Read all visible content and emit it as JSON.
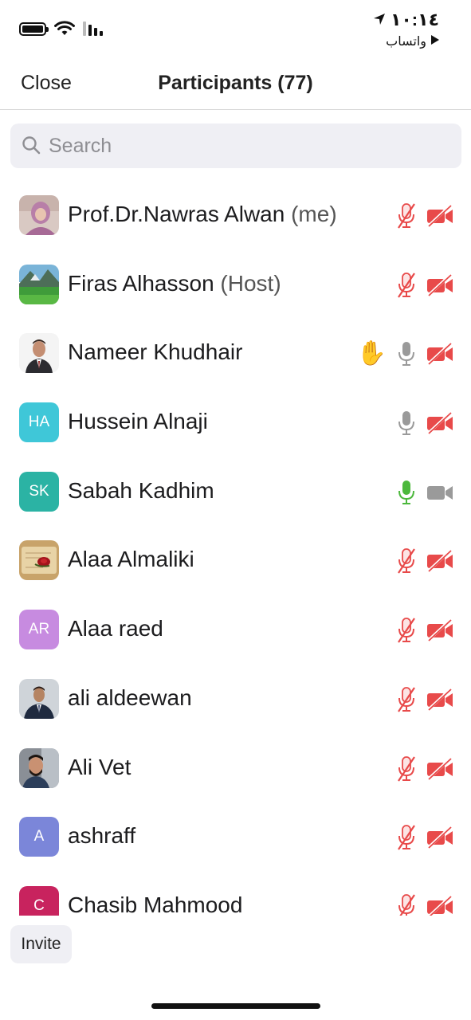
{
  "status_bar": {
    "time": "١٠:١٤",
    "back_app": "واتساب",
    "icons": [
      "battery-icon",
      "wifi-icon",
      "signal-icon",
      "location-arrow-icon"
    ]
  },
  "nav": {
    "close_label": "Close",
    "title": "Participants (77)"
  },
  "search": {
    "placeholder": "Search"
  },
  "colors": {
    "muted_red": "#e84a4a",
    "neutral_gray": "#9a9a9a",
    "active_green": "#4cb83c"
  },
  "participants": [
    {
      "name": "Prof.Dr.Nawras Alwan",
      "suffix": "(me)",
      "avatar": "photo",
      "hand": false,
      "mic": "muted",
      "video": "off"
    },
    {
      "name": "Firas Alhasson",
      "suffix": "(Host)",
      "avatar": "photo",
      "hand": false,
      "mic": "muted",
      "video": "off"
    },
    {
      "name": "Nameer Khudhair",
      "suffix": "",
      "avatar": "photo",
      "hand": true,
      "mic": "unmuted",
      "video": "off"
    },
    {
      "name": "Hussein Alnaji",
      "suffix": "",
      "avatar": "HA",
      "avatar_color": "#3fc7d8",
      "hand": false,
      "mic": "unmuted",
      "video": "off"
    },
    {
      "name": "Sabah Kadhim",
      "suffix": "",
      "avatar": "SK",
      "avatar_color": "#2bb3a4",
      "hand": false,
      "mic": "active",
      "video": "on"
    },
    {
      "name": "Alaa Almaliki",
      "suffix": "",
      "avatar": "photo",
      "hand": false,
      "mic": "muted",
      "video": "off"
    },
    {
      "name": "Alaa raed",
      "suffix": "",
      "avatar": "AR",
      "avatar_color": "#c78be0",
      "hand": false,
      "mic": "muted",
      "video": "off"
    },
    {
      "name": "ali aldeewan",
      "suffix": "",
      "avatar": "photo",
      "hand": false,
      "mic": "muted",
      "video": "off"
    },
    {
      "name": "Ali Vet",
      "suffix": "",
      "avatar": "photo",
      "hand": false,
      "mic": "muted",
      "video": "off"
    },
    {
      "name": "ashraff",
      "suffix": "",
      "avatar": "A",
      "avatar_color": "#7b86d9",
      "hand": false,
      "mic": "muted",
      "video": "off"
    },
    {
      "name": "Chasib Mahmood",
      "suffix": "",
      "avatar": "C",
      "avatar_color": "#c8235e",
      "hand": false,
      "mic": "muted",
      "video": "off"
    }
  ],
  "invite_label": "Invite"
}
